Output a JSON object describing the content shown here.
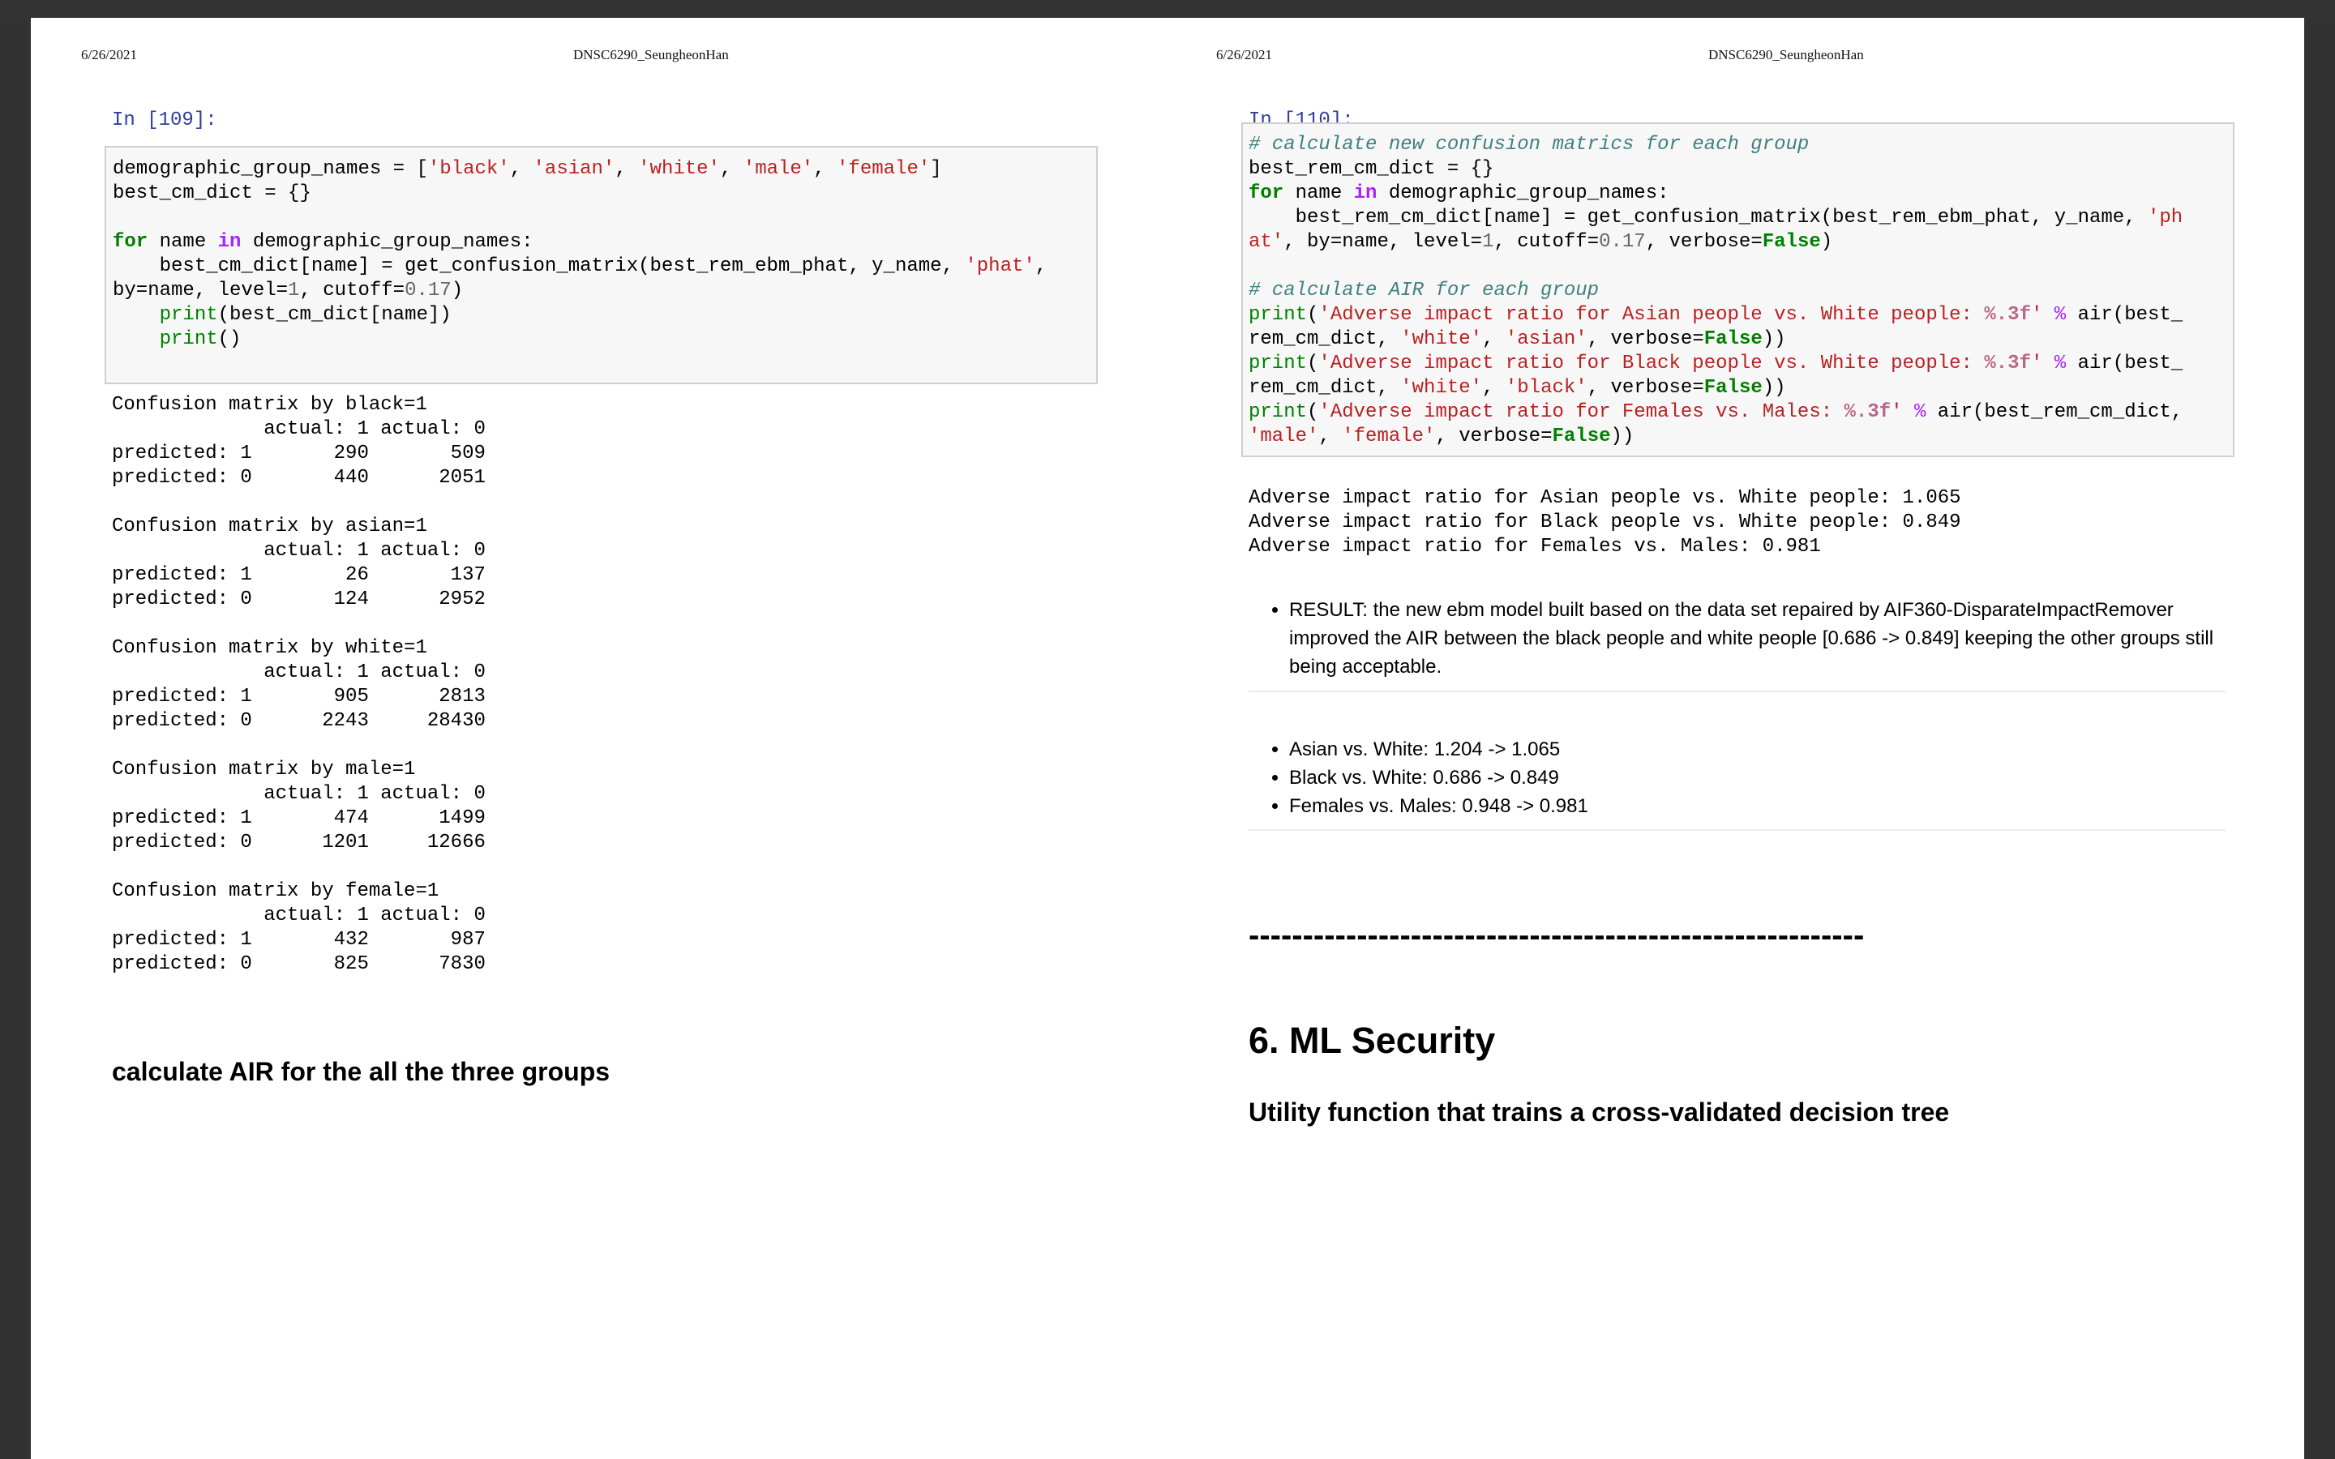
{
  "left_page": {
    "date": "6/26/2021",
    "title": "DNSC6290_SeungheonHan",
    "prompt": "In [109]:",
    "output_lines": [
      "Confusion matrix by black=1",
      "             actual: 1 actual: 0",
      "predicted: 1       290       509",
      "predicted: 0       440      2051",
      "",
      "Confusion matrix by asian=1",
      "             actual: 1 actual: 0",
      "predicted: 1        26       137",
      "predicted: 0       124      2952",
      "",
      "Confusion matrix by white=1",
      "             actual: 1 actual: 0",
      "predicted: 1       905      2813",
      "predicted: 0      2243     28430",
      "",
      "Confusion matrix by male=1",
      "             actual: 1 actual: 0",
      "predicted: 1       474      1499",
      "predicted: 0      1201     12666",
      "",
      "Confusion matrix by female=1",
      "             actual: 1 actual: 0",
      "predicted: 1       432       987",
      "predicted: 0       825      7830"
    ],
    "heading": "calculate AIR for the all the three groups"
  },
  "right_page": {
    "date": "6/26/2021",
    "title": "DNSC6290_SeungheonHan",
    "prompt": "In [110]:",
    "output_lines": [
      "Adverse impact ratio for Asian people vs. White people: 1.065",
      "Adverse impact ratio for Black people vs. White people: 0.849",
      "Adverse impact ratio for Females vs. Males: 0.981"
    ],
    "result_bullet": "RESULT: the new ebm model built based on the data set repaired by AIF360-DisparateImpactRemover improved the AIR between the black people and white people [0.686 -> 0.849] keeping the other groups still being acceptable.",
    "comparison_bullets": [
      "Asian vs. White: 1.204 -> 1.065",
      "Black vs. White: 0.686 -> 0.849",
      "Females vs. Males: 0.948 -> 0.981"
    ],
    "separator": "---------------------------------------------------------",
    "section_heading": "6. ML Security",
    "subheading": "Utility function that trains a cross-validated decision tree"
  }
}
